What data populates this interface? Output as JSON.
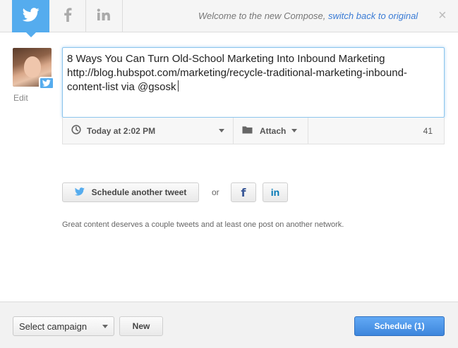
{
  "header": {
    "tabs": [
      {
        "network": "twitter",
        "icon": "twitter-bird-icon",
        "active": true
      },
      {
        "network": "facebook",
        "icon": "facebook-icon",
        "active": false
      },
      {
        "network": "linkedin",
        "icon": "linkedin-icon",
        "active": false
      }
    ],
    "welcome_text": "Welcome to the new Compose,",
    "switch_link": "switch back to original",
    "close_symbol": "×"
  },
  "profile": {
    "edit_label": "Edit"
  },
  "compose": {
    "text": "8 Ways You Can Turn Old-School Marketing Into Inbound Marketing http://blog.hubspot.com/marketing/recycle-traditional-marketing-inbound-content-list via @gsosk"
  },
  "meta": {
    "time_label": "Today at 2:02 PM",
    "attach_label": "Attach",
    "char_count": "41"
  },
  "actions": {
    "schedule_another": "Schedule another tweet",
    "or_label": "or",
    "facebook_glyph": "f",
    "linkedin_glyph": "in"
  },
  "hint": "Great content deserves a couple tweets and at least one post on another network.",
  "footer": {
    "campaign_placeholder": "Select campaign",
    "new_label": "New",
    "schedule_label": "Schedule (1)"
  },
  "colors": {
    "twitter_blue": "#55acee",
    "facebook_blue": "#3b5998",
    "linkedin_blue": "#0077b5",
    "primary_button": "#3d86dc"
  }
}
